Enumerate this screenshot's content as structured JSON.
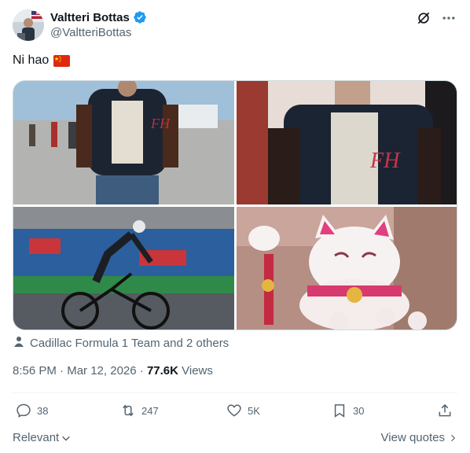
{
  "author": {
    "name": "Valtteri Bottas",
    "handle": "@ValtteriBottas",
    "verified_icon": "verified-badge-icon",
    "brand_color": "#1d9bf0"
  },
  "top_actions": [
    "grok-icon",
    "more-icon"
  ],
  "tweet": {
    "text": "Ni hao",
    "emoji": "china-flag"
  },
  "media": [
    {
      "name": "photo-1",
      "desc_icon": "photo"
    },
    {
      "name": "photo-2",
      "desc_icon": "photo"
    },
    {
      "name": "photo-3",
      "desc_icon": "photo"
    },
    {
      "name": "photo-4",
      "desc_icon": "photo"
    }
  ],
  "tagged": {
    "icon": "person-icon",
    "text": "Cadillac Formula 1 Team and 2 others"
  },
  "meta": {
    "time": "8:56 PM",
    "separator": " · ",
    "date": "Mar 12, 2026",
    "views_count": "77.6K",
    "views_label": " Views"
  },
  "actions": {
    "replies": "38",
    "reposts": "247",
    "likes": "5K",
    "bookmarks": "30"
  },
  "footer": {
    "sort_label": "Relevant",
    "view_quotes": "View quotes"
  }
}
